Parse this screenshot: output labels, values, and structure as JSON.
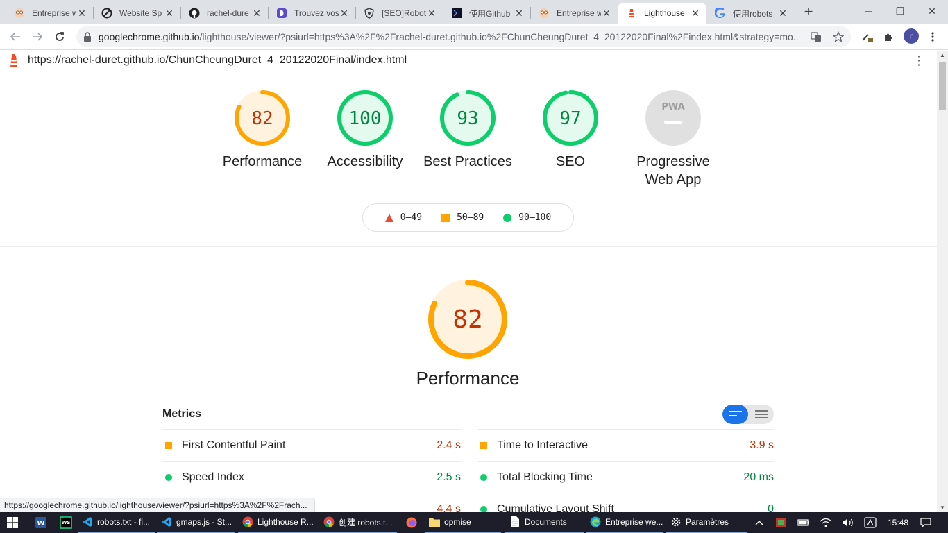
{
  "browser": {
    "tabs": [
      {
        "title": "Entreprise w",
        "icon": "owl-icon",
        "active": false
      },
      {
        "title": "Website Sp",
        "icon": "no-sign-icon",
        "active": false
      },
      {
        "title": "rachel-dure",
        "icon": "github-icon",
        "active": false
      },
      {
        "title": "Trouvez vos",
        "icon": "d-logo-icon",
        "active": false
      },
      {
        "title": "[SEO]Robot",
        "icon": "shield-icon",
        "active": false
      },
      {
        "title": "使用Github",
        "icon": "dark-square-icon",
        "active": false
      },
      {
        "title": "Entreprise w",
        "icon": "owl-icon",
        "active": false
      },
      {
        "title": "Lighthouse",
        "icon": "lighthouse-icon",
        "active": true
      },
      {
        "title": "使用robots",
        "icon": "google-icon",
        "active": false
      }
    ],
    "address": {
      "host": "googlechrome.github.io",
      "rest": "/lighthouse/viewer/?psiurl=https%3A%2F%2Frachel-duret.github.io%2FChunCheungDuret_4_20122020Final%2Findex.html&strategy=mo..."
    },
    "profile_initial": "r",
    "status_url": "https://googlechrome.github.io/lighthouse/viewer/?psiurl=https%3A%2F%2Frach..."
  },
  "report": {
    "url": "https://rachel-duret.github.io/ChunCheungDuret_4_20122020Final/index.html",
    "categories": [
      {
        "label": "Performance",
        "score": "82",
        "status": "average"
      },
      {
        "label": "Accessibility",
        "score": "100",
        "status": "pass"
      },
      {
        "label": "Best Practices",
        "score": "93",
        "status": "pass"
      },
      {
        "label": "SEO",
        "score": "97",
        "status": "pass"
      },
      {
        "label_line1": "Progressive",
        "label_line2": "Web App",
        "badge": "PWA",
        "status": "na"
      }
    ],
    "legend": [
      {
        "range": "0–49",
        "shape": "triangle",
        "color": "#eb4a36"
      },
      {
        "range": "50–89",
        "shape": "square",
        "color": "#ffa400"
      },
      {
        "range": "90–100",
        "shape": "circle",
        "color": "#0cce6b"
      }
    ],
    "performance": {
      "score": "82",
      "title": "Performance",
      "metrics_header": "Metrics",
      "left_metrics": [
        {
          "name": "First Contentful Paint",
          "value": "2.4 s",
          "status": "average"
        },
        {
          "name": "Speed Index",
          "value": "2.5 s",
          "status": "pass"
        },
        {
          "name": "",
          "value": "4.4 s",
          "status": "average"
        }
      ],
      "right_metrics": [
        {
          "name": "Time to Interactive",
          "value": "3.9 s",
          "status": "average"
        },
        {
          "name": "Total Blocking Time",
          "value": "20 ms",
          "status": "pass"
        },
        {
          "name": "Cumulative Layout Shift",
          "value": "0",
          "status": "pass"
        }
      ]
    }
  },
  "taskbar": {
    "items": [
      {
        "label": "robots.txt - fi...",
        "icon": "vscode-icon"
      },
      {
        "label": "gmaps.js - St...",
        "icon": "vscode-icon"
      },
      {
        "label": "Lighthouse R...",
        "icon": "chrome-icon"
      },
      {
        "label": "创建 robots.t...",
        "icon": "chrome-icon"
      },
      {
        "label": "opmise",
        "icon": "folder-icon"
      },
      {
        "label": "Documents",
        "icon": "document-icon"
      },
      {
        "label": "Entreprise we...",
        "icon": "edge-icon"
      },
      {
        "label": "Paramètres",
        "icon": "gear-icon"
      }
    ],
    "clock": "15:48"
  },
  "colors": {
    "average": "#ffa400",
    "average_fill": "#fff3e0",
    "pass": "#0cce6b",
    "pass_fill": "#e5faef",
    "fail": "#eb4a36",
    "pass_text": "#018642",
    "average_text": "#c33300"
  }
}
